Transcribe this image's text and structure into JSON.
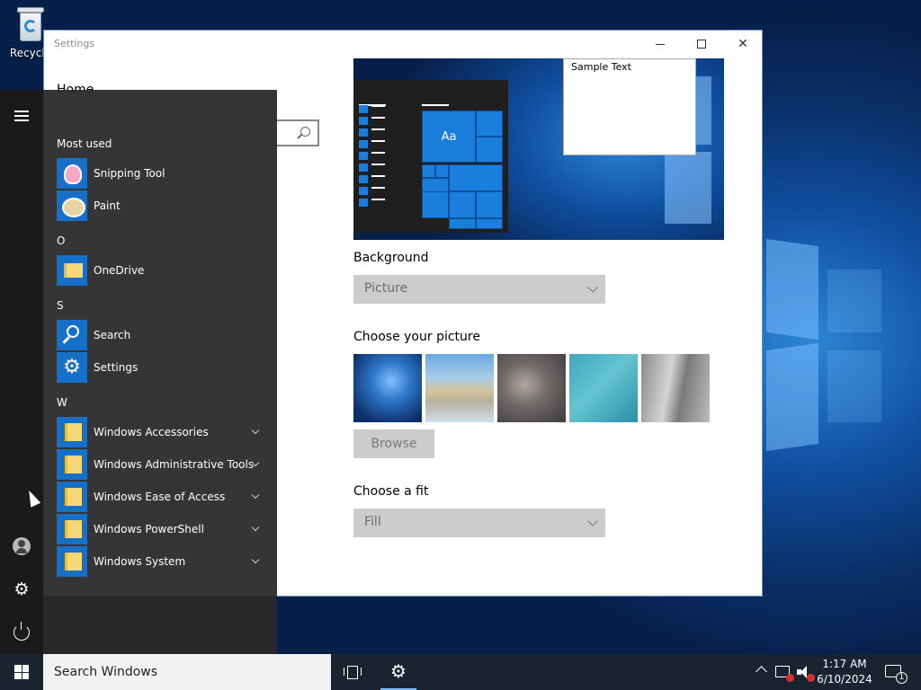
{
  "desktop": {
    "recycle_bin_label": "Recycle"
  },
  "settings_window": {
    "title": "Settings",
    "home_label": "Home",
    "preview": {
      "sample_text": "Sample Text",
      "tile_label": "Aa"
    },
    "background": {
      "label": "Background",
      "selected": "Picture"
    },
    "choose_picture": {
      "label": "Choose your picture",
      "browse_label": "Browse"
    },
    "choose_fit": {
      "label": "Choose a fit",
      "selected": "Fill"
    }
  },
  "start_menu": {
    "sections": [
      {
        "header": "Most used",
        "apps": [
          "Snipping Tool",
          "Paint"
        ]
      },
      {
        "header": "O",
        "apps": [
          "OneDrive"
        ]
      },
      {
        "header": "S",
        "apps": [
          "Search",
          "Settings"
        ]
      },
      {
        "header": "W",
        "apps": [
          "Windows Accessories",
          "Windows Administrative Tools",
          "Windows Ease of Access",
          "Windows PowerShell",
          "Windows System"
        ]
      }
    ]
  },
  "taskbar": {
    "search_placeholder": "Search Windows",
    "time": "1:17 AM",
    "date": "6/10/2024",
    "notification_count": "1"
  },
  "colors": {
    "accent": "#1670c8",
    "tile_blue": "#1a7fdc",
    "start_bg": "#282828",
    "taskbar_bg": "#1a2330"
  }
}
